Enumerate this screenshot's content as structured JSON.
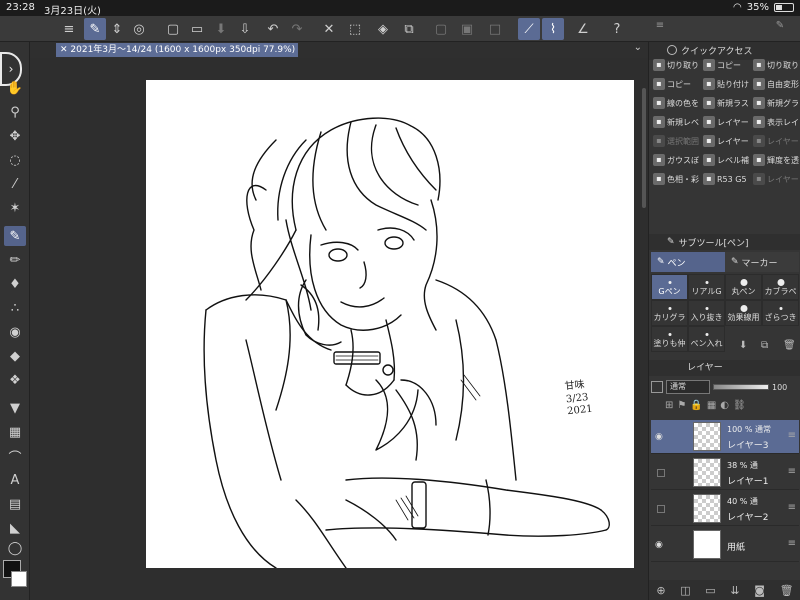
{
  "status": {
    "time": "23:28",
    "date": "3月23日(火)",
    "battery": "35%",
    "battery_level": 0.35
  },
  "toolbar": {
    "icons": [
      "menu-icon",
      "pen-select-icon",
      "toggle-icon",
      "record-icon",
      "new-icon",
      "open-icon",
      "save-icon",
      "undo-icon",
      "redo-icon",
      "clear-icon",
      "fill-icon",
      "transform-icon",
      "snap-icon",
      "ruler-icon",
      "special-ruler-icon",
      "ruler-edit-icon",
      "help-icon"
    ]
  },
  "document": {
    "tab_label": "2021年3月～14/24 (1600 x 1600px 350dpi 77.9%)"
  },
  "quick_access": {
    "title": "クイックアクセス",
    "items": [
      {
        "label": "切り取り",
        "dim": false
      },
      {
        "label": "コピー",
        "dim": false
      },
      {
        "label": "切り取り",
        "dim": false
      },
      {
        "label": "コピー",
        "dim": false
      },
      {
        "label": "貼り付け",
        "dim": false
      },
      {
        "label": "自由変形",
        "dim": false
      },
      {
        "label": "線の色を",
        "dim": false
      },
      {
        "label": "新規ラス",
        "dim": false
      },
      {
        "label": "新規グラ",
        "dim": false
      },
      {
        "label": "新規レベ",
        "dim": false
      },
      {
        "label": "レイヤー",
        "dim": false
      },
      {
        "label": "表示レイ",
        "dim": false
      },
      {
        "label": "選択範囲",
        "dim": true
      },
      {
        "label": "レイヤー",
        "dim": false
      },
      {
        "label": "レイヤー",
        "dim": true
      },
      {
        "label": "ガウスぼ",
        "dim": false
      },
      {
        "label": "レベル補",
        "dim": false
      },
      {
        "label": "輝度を透",
        "dim": false
      },
      {
        "label": "色相・彩",
        "dim": false
      },
      {
        "label": "R53 G5",
        "dim": false
      },
      {
        "label": "レイヤー",
        "dim": true
      }
    ]
  },
  "subtool": {
    "title": "サブツール[ペン]",
    "tabs": [
      {
        "label": "ペン",
        "on": true
      },
      {
        "label": "マーカー",
        "on": false
      }
    ],
    "brushes": [
      {
        "label": "Gペン",
        "on": true,
        "big": false
      },
      {
        "label": "リアルG",
        "on": false,
        "big": false
      },
      {
        "label": "丸ペン",
        "on": false,
        "big": true
      },
      {
        "label": "カブラペ",
        "on": false,
        "big": true
      },
      {
        "label": "カリグラ",
        "on": false,
        "big": false
      },
      {
        "label": "入り抜き",
        "on": false,
        "big": false
      },
      {
        "label": "効果線用",
        "on": false,
        "big": true
      },
      {
        "label": "ざらつき",
        "on": false,
        "big": false
      },
      {
        "label": "塗りも仲",
        "on": false,
        "big": false
      },
      {
        "label": "ペン入れ",
        "on": false,
        "big": false
      }
    ]
  },
  "layers": {
    "title": "レイヤー",
    "blend_mode": "通常",
    "opacity": "100",
    "items": [
      {
        "opacity": "100 %",
        "mode": "通常",
        "name": "レイヤー3",
        "on": true,
        "visible": true,
        "paper": false
      },
      {
        "opacity": "38 %",
        "mode": "通",
        "name": "レイヤー1",
        "on": false,
        "visible": false,
        "paper": false
      },
      {
        "opacity": "40 %",
        "mode": "通",
        "name": "レイヤー2",
        "on": false,
        "visible": false,
        "paper": false
      },
      {
        "opacity": "",
        "mode": "",
        "name": "用紙",
        "on": false,
        "visible": true,
        "paper": true
      }
    ]
  },
  "signature": {
    "name": "甘味",
    "date": "3/23",
    "year": "2021"
  }
}
